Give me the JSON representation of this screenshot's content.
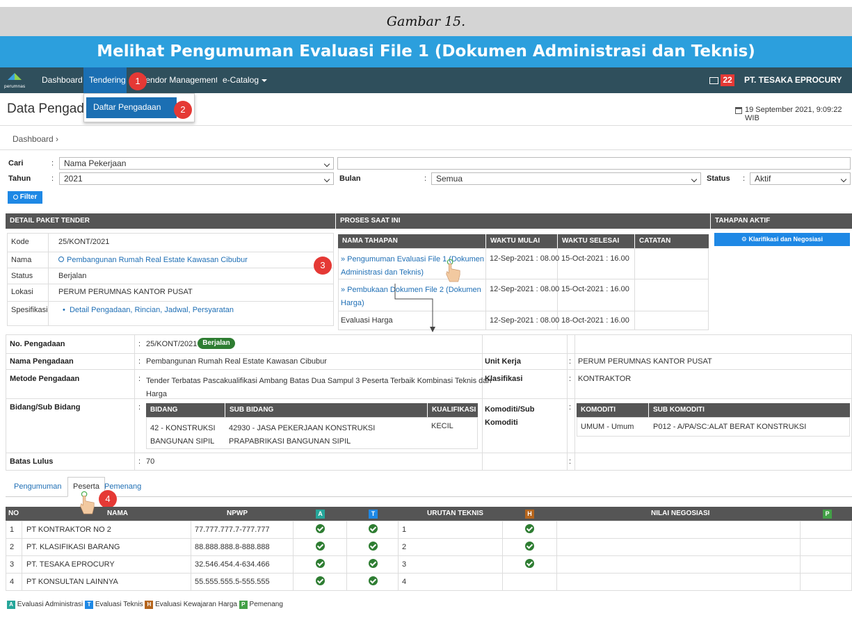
{
  "caption": "Gambar 15.",
  "title": "Melihat Pengumuman Evaluasi File 1 (Dokumen Administrasi dan Teknis)",
  "nav": {
    "dashboard": "Dashboard",
    "tendering": "Tendering",
    "vendor": "Vendor Management",
    "catalog": "e-Catalog",
    "mail_count": "22",
    "company": "PT. TESAKA EPROCURY"
  },
  "dropdown": {
    "item": "Daftar Pengadaan"
  },
  "steps": [
    "1",
    "2",
    "3",
    "4"
  ],
  "page": {
    "title": "Data Pengad",
    "datetime": "19 September 2021, 9:09:22 WIB",
    "breadcrumb": "Dashboard ›"
  },
  "filter": {
    "cari_label": "Cari",
    "cari_value": "Nama Pekerjaan",
    "cari_text": "",
    "tahun_label": "Tahun",
    "tahun_value": "2021",
    "bulan_label": "Bulan",
    "bulan_value": "Semua",
    "status_label": "Status",
    "status_value": "Aktif",
    "button": "Filter",
    "colon": ":"
  },
  "detail": {
    "header": "DETAIL PAKET TENDER",
    "rows": [
      {
        "label": "Kode",
        "value": "25/KONT/2021"
      },
      {
        "label": "Nama",
        "value": "Pembangunan Rumah Real Estate Kawasan Cibubur"
      },
      {
        "label": "Status",
        "value": "Berjalan"
      },
      {
        "label": "Lokasi",
        "value": "PERUM PERUMNAS KANTOR PUSAT"
      },
      {
        "label": "Spesifikasi",
        "value": "Detail Pengadaan, Rincian, Jadwal, Persyaratan"
      }
    ]
  },
  "proses": {
    "header": "PROSES SAAT INI",
    "columns": [
      "NAMA TAHAPAN",
      "WAKTU MULAI",
      "WAKTU SELESAI",
      "CATATAN"
    ],
    "rows": [
      {
        "name1": "» Pengumuman Evaluasi File 1 (Dokumen",
        "name2": "Administrasi dan Teknis)",
        "mulai": "12-Sep-2021 : 08.00",
        "selesai": "15-Oct-2021 : 16.00"
      },
      {
        "name1": "» Pembukaan Dokumen File 2 (Dokumen",
        "name2": "Harga)",
        "mulai": "12-Sep-2021 : 08.00",
        "selesai": "15-Oct-2021 : 16.00"
      },
      {
        "name1": "Evaluasi Harga",
        "name2": "",
        "mulai": "12-Sep-2021 : 08.00",
        "selesai": "18-Oct-2021 : 16.00"
      }
    ]
  },
  "tahapan": {
    "header": "TAHAPAN AKTIF",
    "button": "Klarifikasi dan Negosiasi"
  },
  "info": {
    "no_label": "No. Pengadaan",
    "no_value": "25/KONT/2021",
    "status_badge": "Berjalan",
    "nama_label": "Nama Pengadaan",
    "nama_value": "Pembangunan Rumah Real Estate Kawasan Cibubur",
    "unit_label": "Unit Kerja",
    "unit_value": "PERUM PERUMNAS KANTOR PUSAT",
    "metode_label": "Metode Pengadaan",
    "metode_value1": "Tender Terbatas Pascakualifikasi Ambang Batas Dua Sampul 3 Peserta Terbaik Kombinasi Teknis dan",
    "metode_value2": "Harga",
    "klas_label": "Klasifikasi",
    "klas_value": "KONTRAKTOR",
    "bidang_label": "Bidang/Sub Bidang",
    "bidang_cols": [
      "BIDANG",
      "SUB BIDANG",
      "KUALIFIKASI"
    ],
    "bidang_row": {
      "bidang1": "42 - KONSTRUKSI",
      "bidang2": "BANGUNAN SIPIL",
      "sub1": "42930 - JASA PEKERJAAN KONSTRUKSI",
      "sub2": "PRAPABRIKASI BANGUNAN SIPIL",
      "kual": "KECIL"
    },
    "komoditi_label1": "Komoditi/Sub",
    "komoditi_label2": "Komoditi",
    "komoditi_cols": [
      "KOMODITI",
      "SUB KOMODITI"
    ],
    "komoditi_row": {
      "kom": "UMUM - Umum",
      "sub": "P012 - A/PA/SC:ALAT BERAT KONSTRUKSI"
    },
    "batas_label": "Batas Lulus",
    "batas_value": "70"
  },
  "tabs": [
    "Pengumuman",
    "Peserta",
    "Pemenang"
  ],
  "peserta": {
    "columns": {
      "no": "NO",
      "nama": "NAMA",
      "npwp": "NPWP",
      "a": "A",
      "t": "T",
      "urutan": "URUTAN TEKNIS",
      "h": "H",
      "nilai": "NILAI NEGOSIASI",
      "p": "P"
    },
    "rows": [
      {
        "no": "1",
        "nama": "PT KONTRAKTOR NO 2",
        "npwp": "77.777.777.7-777.777",
        "urutan": "1",
        "h": true
      },
      {
        "no": "2",
        "nama": "PT. KLASIFIKASI BARANG",
        "npwp": "88.888.888.8-888.888",
        "urutan": "2",
        "h": true
      },
      {
        "no": "3",
        "nama": "PT. TESAKA EPROCURY",
        "npwp": "32.546.454.4-634.466",
        "urutan": "3",
        "h": true
      },
      {
        "no": "4",
        "nama": "PT KONSULTAN LAINNYA",
        "npwp": "55.555.555.5-555.555",
        "urutan": "4",
        "h": false
      }
    ]
  },
  "legend": [
    {
      "key": "A",
      "text": "Evaluasi Administrasi",
      "color": "#26a69a"
    },
    {
      "key": "T",
      "text": "Evaluasi Teknis",
      "color": "#1e88e5"
    },
    {
      "key": "H",
      "text": "Evaluasi Kewajaran Harga",
      "color": "#b5651d"
    },
    {
      "key": "P",
      "text": "Pemenang",
      "color": "#43a047"
    }
  ],
  "colors": {
    "navbar": "#2f4f5c",
    "title": "#2c9fdd",
    "active": "#1b6fb3",
    "step": "#e53935",
    "check": "#2e7d32"
  }
}
